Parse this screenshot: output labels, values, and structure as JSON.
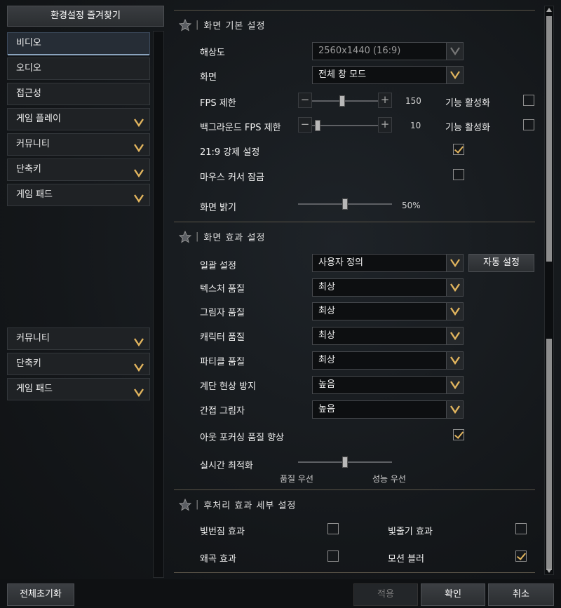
{
  "sidebar": {
    "favorites_label": "환경설정 즐겨찾기",
    "items": [
      {
        "label": "비디오",
        "chevron": false
      },
      {
        "label": "오디오",
        "chevron": false
      },
      {
        "label": "접근성",
        "chevron": false
      },
      {
        "label": "게임 플레이",
        "chevron": true
      },
      {
        "label": "커뮤니티",
        "chevron": true
      },
      {
        "label": "단축키",
        "chevron": true
      },
      {
        "label": "게임 패드",
        "chevron": true
      }
    ],
    "items_lower": [
      {
        "label": "커뮤니티",
        "chevron": true
      },
      {
        "label": "단축키",
        "chevron": true
      },
      {
        "label": "게임 패드",
        "chevron": true
      }
    ]
  },
  "basic": {
    "title": "화면 기본 설정",
    "resolution_label": "해상도",
    "resolution_value": "2560x1440 (16:9)",
    "screen_label": "화면",
    "screen_value": "전체 창 모드",
    "fps_label": "FPS 제한",
    "fps_value": "150",
    "fps_level": 0.45,
    "fps_enable_label": "기능 활성화",
    "fps_enable_checked": false,
    "bg_fps_label": "백그라운드 FPS 제한",
    "bg_fps_value": "10",
    "bg_fps_level": 0.05,
    "bg_fps_enable_label": "기능 활성화",
    "bg_fps_enable_checked": false,
    "ratio_label": "21:9 강제 설정",
    "ratio_checked": true,
    "cursor_lock_label": "마우스 커서 잠금",
    "cursor_lock_checked": false,
    "brightness_label": "화면 밝기",
    "brightness_value": "50%",
    "brightness_level": 0.5
  },
  "effects": {
    "title": "화면 효과 설정",
    "preset_label": "일괄 설정",
    "preset_value": "사용자 정의",
    "auto_button": "자동 설정",
    "texture_label": "텍스처 품질",
    "texture_value": "최상",
    "shadow_label": "그림자 품질",
    "shadow_value": "최상",
    "character_label": "캐릭터 품질",
    "character_value": "최상",
    "particle_label": "파티클 품질",
    "particle_value": "최상",
    "aa_label": "계단 현상 방지",
    "aa_value": "높음",
    "indirect_label": "간접 그림자",
    "indirect_value": "높음",
    "outfocus_label": "아웃 포커싱 품질 향상",
    "outfocus_checked": true,
    "realtime_label": "실시간 최적화",
    "realtime_level": 0.5,
    "quality_first": "품질 우선",
    "performance_first": "성능 우선"
  },
  "post": {
    "title": "후처리 효과 세부 설정",
    "bloom_label": "빛번짐 효과",
    "bloom_checked": false,
    "lightshaft_label": "빛줄기 효과",
    "lightshaft_checked": false,
    "distortion_label": "왜곡 효과",
    "distortion_checked": false,
    "motionblur_label": "모션 블러",
    "motionblur_checked": true
  },
  "footer": {
    "reset_all": "전체초기화",
    "apply": "적용",
    "confirm": "확인",
    "cancel": "취소"
  },
  "colors": {
    "accent": "#e2b55e",
    "selected": "#8aa3bd"
  }
}
